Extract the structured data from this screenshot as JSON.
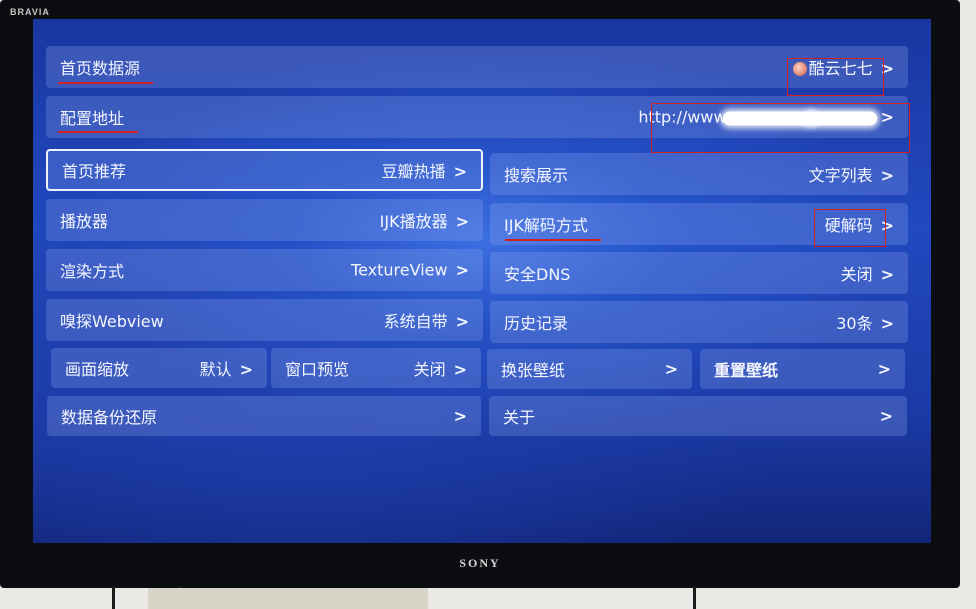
{
  "tv": {
    "brand_top": "BRAVIA",
    "brand_bottom": "SONY"
  },
  "settings": {
    "home_source": {
      "label": "首页数据源",
      "value": "酷云七七",
      "arrow": ">"
    },
    "config_url": {
      "label": "配置地址",
      "value_prefix": "http://www",
      "arrow": ">"
    },
    "home_rec": {
      "label": "首页推荐",
      "value": "豆瓣热播",
      "arrow": ">"
    },
    "search_display": {
      "label": "搜索展示",
      "value": "文字列表",
      "arrow": ">"
    },
    "player": {
      "label": "播放器",
      "value": "IJK播放器",
      "arrow": ">"
    },
    "ijk_decode": {
      "label": "IJK解码方式",
      "value": "硬解码",
      "arrow": ">"
    },
    "render": {
      "label": "渲染方式",
      "value": "TextureView",
      "arrow": ">"
    },
    "safe_dns": {
      "label": "安全DNS",
      "value": "关闭",
      "arrow": ">"
    },
    "sniff": {
      "label": "嗅探Webview",
      "value": "系统自带",
      "arrow": ">"
    },
    "history": {
      "label": "历史记录",
      "value": "30条",
      "arrow": ">"
    },
    "scale": {
      "label": "画面缩放",
      "value": "默认",
      "arrow": ">"
    },
    "preview": {
      "label": "窗口预览",
      "value": "关闭",
      "arrow": ">"
    },
    "wallpaper": {
      "label": "换张壁纸",
      "arrow": ">"
    },
    "reset_wall": {
      "label": "重置壁纸",
      "arrow": ">"
    },
    "backup": {
      "label": "数据备份还原",
      "arrow": ">"
    },
    "about": {
      "label": "关于",
      "arrow": ">"
    }
  },
  "colors": {
    "annotation": "#d42020",
    "panel_bg": "#2149c0",
    "text": "#f4f6ff"
  }
}
